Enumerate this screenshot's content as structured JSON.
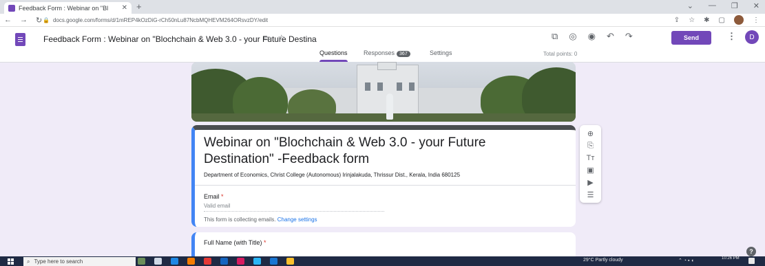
{
  "browser": {
    "tab_title": "Feedback Form : Webinar on \"Bl",
    "url": "docs.google.com/forms/d/1mREP4kOzDiG-rCh50nLu87NcbMQHEVM264ORsvzDY/edit"
  },
  "forms_header": {
    "title": "Feedback Form : Webinar on \"Blochchain & Web 3.0 - your Future Destina",
    "send_label": "Send",
    "avatar_letter": "D",
    "tabs": [
      {
        "label": "Questions"
      },
      {
        "label": "Responses",
        "count": "367"
      },
      {
        "label": "Settings"
      }
    ],
    "total_points": "Total points: 0"
  },
  "form": {
    "heading": "Webinar on \"Blochchain & Web 3.0 - your Future Destination\" -Feedback form",
    "description": "Department of Economics, Christ College (Autonomous) Irinjalakuda, Thrissur Dist., Kerala, India 680125",
    "email_label": "Email",
    "required_mark": "*",
    "email_placeholder": "Valid email",
    "collecting_text": "This form is collecting emails.",
    "change_settings": "Change settings",
    "question_title": "Full Name (with Title)"
  },
  "taskbar": {
    "search_placeholder": "Type here to search",
    "weather": "29°C  Partly cloudy",
    "time": "10:26 PM"
  },
  "icons": {
    "floatbar": [
      "add-question-icon",
      "import-questions-icon",
      "add-title-icon",
      "add-image-icon",
      "add-video-icon",
      "add-section-icon"
    ]
  },
  "colors": {
    "brand": "#7248b9",
    "accent_border": "#4285f4",
    "background": "#f0ebf8"
  }
}
